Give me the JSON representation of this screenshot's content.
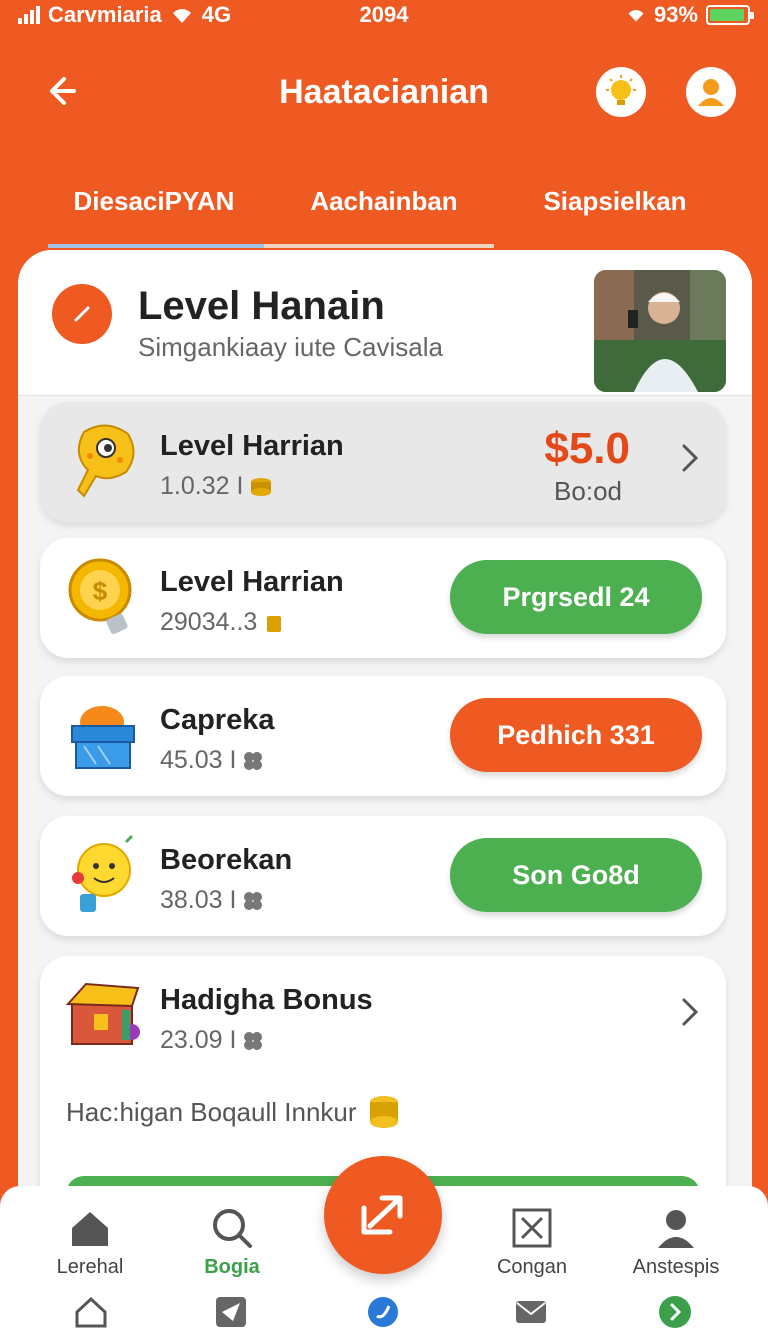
{
  "status_bar": {
    "carrier": "Carvmiaria",
    "network": "4G",
    "time": "2094",
    "battery": "93%"
  },
  "header": {
    "title": "Haatacianian"
  },
  "tabs": [
    {
      "label": "DiesaciPYAN"
    },
    {
      "label": "Aachainban"
    },
    {
      "label": "Siapsielkan"
    }
  ],
  "hero": {
    "title": "Level Hanain",
    "subtitle": "Simgankiaay iute Cavisala"
  },
  "rows": [
    {
      "name": "Level Harrian",
      "meta": "1.0.32 I",
      "price": "$5.0",
      "price_sub": "Bo:od"
    },
    {
      "name": "Level Harrian",
      "meta": "29034..3",
      "button": "Prgrsedl 24"
    },
    {
      "name": "Capreka",
      "meta": "45.03 I",
      "button": "Pedhich 331"
    },
    {
      "name": "Beorekan",
      "meta": "38.03 I",
      "button": "Son Go8d"
    }
  ],
  "bonus": {
    "name": "Hadigha Bonus",
    "meta": "23.09 I",
    "note": "Hac:higan Boqaull Innkur"
  },
  "bottom_nav": [
    {
      "label": "Lerehal"
    },
    {
      "label": "Bogia"
    },
    {
      "label": "Congan"
    },
    {
      "label": "Anstespis"
    }
  ],
  "colors": {
    "brand": "#ee5a22",
    "green": "#4caf50",
    "price": "#e24a1a"
  }
}
